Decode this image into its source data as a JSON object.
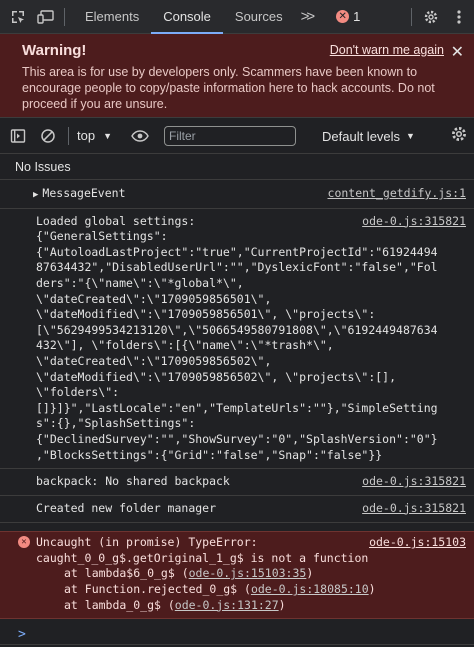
{
  "tabs": {
    "elements": "Elements",
    "console": "Console",
    "sources": "Sources",
    "more": ">>",
    "error_count": "1"
  },
  "warning": {
    "title": "Warning!",
    "dont_warn": "Don't warn me again",
    "text": "This area is for use by developers only. Scammers have been known to encourage people to copy/paste information here to hack accounts. Do not proceed if you are unsure."
  },
  "toolbar": {
    "context": "top",
    "filter_placeholder": "Filter",
    "levels": "Default levels"
  },
  "issues": "No Issues",
  "messages": {
    "m1": {
      "text": "MessageEvent",
      "source": "content_getdify.js:1"
    },
    "m2": {
      "source": "ode-0.js:315821",
      "lines": [
        "Loaded global settings:",
        "{\"GeneralSettings\":",
        "{\"AutoloadLastProject\":\"true\",\"CurrentProjectId\":\"61924494",
        "87634432\",\"DisabledUserUrl\":\"\",\"DyslexicFont\":\"false\",\"Fol",
        "ders\":\"{\\\"name\\\":\\\"*global*\\\",",
        "\\\"dateCreated\\\":\\\"1709059856501\\\",",
        "\\\"dateModified\\\":\\\"1709059856501\\\", \\\"projects\\\":",
        "[\\\"5629499534213120\\\",\\\"5066549580791808\\\",\\\"6192449487634",
        "432\\\"], \\\"folders\\\":[{\\\"name\\\":\\\"*trash*\\\",",
        "\\\"dateCreated\\\":\\\"1709059856502\\\",",
        "\\\"dateModified\\\":\\\"1709059856502\\\", \\\"projects\\\":[],",
        "\\\"folders\\\":",
        "[]}]}\",\"LastLocale\":\"en\",\"TemplateUrls\":\"\"},\"SimpleSetting",
        "s\":{},\"SplashSettings\":",
        "{\"DeclinedSurvey\":\"\",\"ShowSurvey\":\"0\",\"SplashVersion\":\"0\"}",
        ",\"BlocksSettings\":{\"Grid\":\"false\",\"Snap\":\"false\"}}"
      ]
    },
    "m3": {
      "text": "backpack: No shared backpack",
      "source": "ode-0.js:315821"
    },
    "m4": {
      "text": "Created new folder manager",
      "source": "ode-0.js:315821"
    },
    "error": {
      "source": "ode-0.js:15103",
      "line1": "Uncaught (in promise) TypeError:",
      "line2": "caught_0_0_g$.getOriginal_1_g$ is not a function",
      "stack": [
        {
          "prefix": "at lambda$6_0_g$ (",
          "link": "ode-0.js:15103:35",
          "suffix": ")"
        },
        {
          "prefix": "at Function.rejected_0_g$ (",
          "link": "ode-0.js:18085:10",
          "suffix": ")"
        },
        {
          "prefix": "at lambda_0_g$ (",
          "link": "ode-0.js:131:27",
          "suffix": ")"
        }
      ]
    }
  },
  "prompt": ">"
}
